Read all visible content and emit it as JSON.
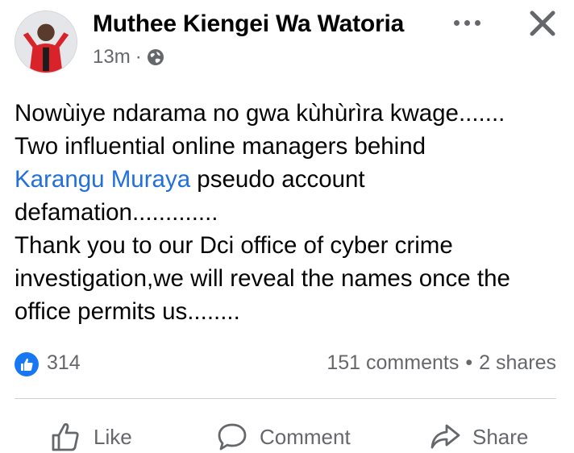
{
  "post": {
    "author": "Muthee Kiengei Wa Watoria",
    "time": "13m",
    "separator": "·",
    "privacy_icon": "globe-icon",
    "avatar_icon": "profile-photo",
    "text": {
      "line1": "Nowùiye ndarama no gwa kùhùrìra kwage.......",
      "line2": "Two influential online managers behind",
      "mention": "Karangu Muraya",
      "line3_rest": " pseudo account",
      "line4": "defamation.............",
      "line5": "Thank you to our Dci office of cyber crime",
      "line6": "investigation,we will reveal the names once the",
      "line7": "office permits us........"
    }
  },
  "stats": {
    "likes": "314",
    "comments": "151 comments",
    "dot": "•",
    "shares": "2 shares"
  },
  "actions": {
    "like": "Like",
    "comment": "Comment",
    "share": "Share"
  },
  "colors": {
    "link": "#216fdb",
    "like_badge": "#1877f2",
    "secondary_text": "#65676b"
  }
}
